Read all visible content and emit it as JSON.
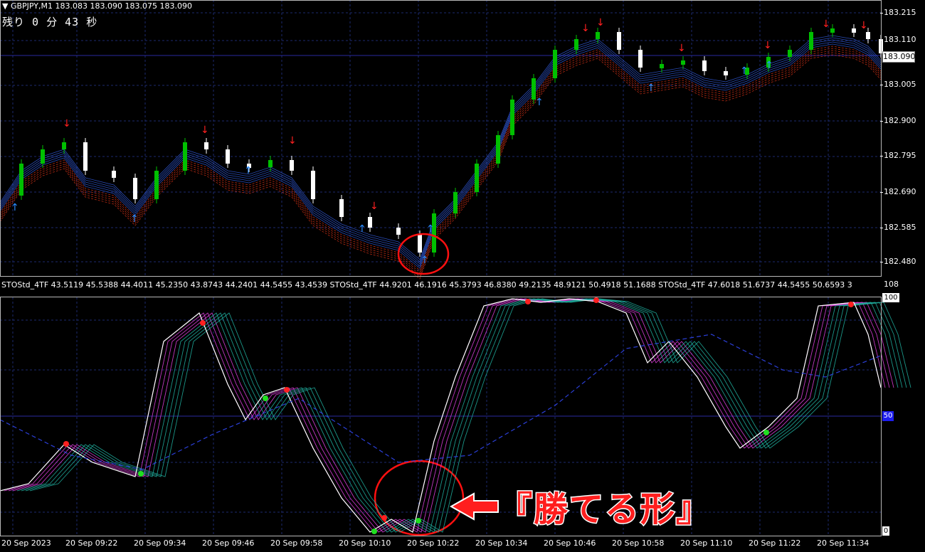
{
  "chart": {
    "symbol_timeframe": "GBPJPY,M1",
    "ohlc": "183.083 183.090 183.075 183.090",
    "timer": "残り 0 分 43 秒",
    "current_price": "183.090"
  },
  "price_axis": [
    "183.215",
    "183.110",
    "183.005",
    "182.900",
    "182.795",
    "182.690",
    "182.585",
    "182.480"
  ],
  "oscillator": {
    "header": "STOStd_4TF 43.5119 45.5388 44.4011 45.2350 43.8743 44.2401 44.5455 43.4539   STOStd_4TF 44.9201 46.1916 45.3793 46.8380 49.2135 48.9121 50.4918 51.1688   STOStd_4TF 47.6018 51.6737 44.5455 50.6593 3",
    "scale_max": "108",
    "level_100": "100",
    "level_50": "50",
    "level_0": "0"
  },
  "time_axis": [
    "20 Sep 2023",
    "20 Sep 09:22",
    "20 Sep 09:34",
    "20 Sep 09:46",
    "20 Sep 09:58",
    "20 Sep 10:10",
    "20 Sep 10:22",
    "20 Sep 10:34",
    "20 Sep 10:46",
    "20 Sep 10:58",
    "20 Sep 11:10",
    "20 Sep 11:22",
    "20 Sep 11:34"
  ],
  "annotation": {
    "text": "『勝てる形』"
  },
  "colors": {
    "grid": "#1c2a6e",
    "bull_candle": "#00c000",
    "bear_candle": "#ffffff",
    "ribbon_down": "#ff3a1a",
    "ribbon_up": "#3a6aff",
    "arrow_sell": "#ff2020",
    "arrow_buy": "#2a8cff",
    "osc_main": "#ffffff",
    "osc_magenta": "#e040e0",
    "osc_teal": "#20b0a0",
    "circle": "#ff1010"
  }
}
